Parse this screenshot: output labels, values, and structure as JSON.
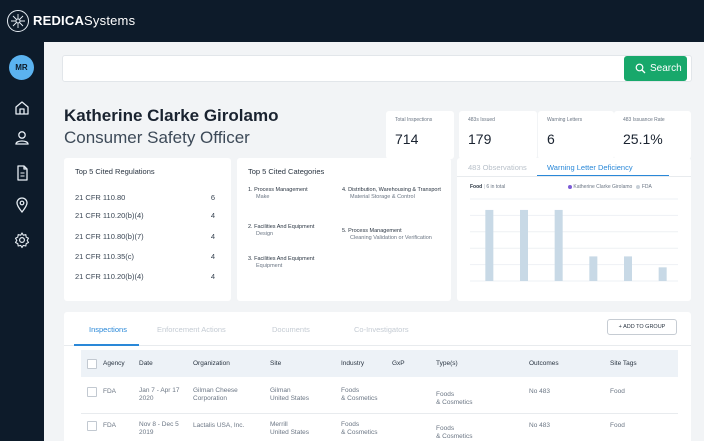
{
  "app": {
    "brand_bold": "REDICA",
    "brand_light": "Systems"
  },
  "user": {
    "initials": "MR"
  },
  "search": {
    "button_label": "Search",
    "placeholder": ""
  },
  "person": {
    "name": "Katherine Clarke Girolamo",
    "title": "Consumer Safety Officer"
  },
  "stats": [
    {
      "label": "Total Inspections",
      "value": "714"
    },
    {
      "label": "483s Issued",
      "value": "179"
    },
    {
      "label": "Warning Letters",
      "value": "6"
    },
    {
      "label": "483 Issuance Rate",
      "value": "25.1%"
    }
  ],
  "regulations": {
    "title": "Top 5 Cited Regulations",
    "items": [
      {
        "name": "21 CFR 110.80",
        "count": "6"
      },
      {
        "name": "21 CFR 110.20(b)(4)",
        "count": "4"
      },
      {
        "name": "21 CFR 110.80(b)(7)",
        "count": "4"
      },
      {
        "name": "21 CFR 110.35(c)",
        "count": "4"
      },
      {
        "name": "21 CFR 110.20(b)(4)",
        "count": "4"
      }
    ]
  },
  "categories": {
    "title": "Top 5 Cited Categories",
    "items": [
      {
        "main": "1. Process Management",
        "sub": "Make"
      },
      {
        "main": "2. Facilities And Equipment",
        "sub": "Design"
      },
      {
        "main": "3. Facilities And Equipment",
        "sub": "Equipment"
      },
      {
        "main": "4. Distribution, Warehousing & Transport",
        "sub": "Material Storage & Control"
      },
      {
        "main": "5. Process Management",
        "sub": "Cleaning Validation or Verification"
      }
    ]
  },
  "chart_panel": {
    "tabs": [
      "483 Observations",
      "Warning Letter Deficiency"
    ],
    "active_tab": 1,
    "filter_label": "Food",
    "filter_count": "6 in total",
    "legend": [
      {
        "name": "Katherine Clarke Girolamo",
        "color": "#7c5cd6"
      },
      {
        "name": "FDA",
        "color": "#c8d0d8"
      }
    ]
  },
  "chart_data": {
    "type": "bar",
    "categories": [
      "1",
      "2",
      "3",
      "4",
      "5",
      "6"
    ],
    "series": [
      {
        "name": "Katherine Clarke Girolamo",
        "color": "#7c5cd6",
        "values": [
          0,
          0,
          0,
          0,
          0,
          0
        ]
      },
      {
        "name": "FDA",
        "color": "#c8d9e6",
        "values": [
          5.2,
          5.2,
          5.2,
          1.8,
          1.8,
          1
        ]
      }
    ],
    "title": "",
    "xlabel": "",
    "ylabel": "",
    "ylim": [
      0,
      6
    ],
    "grid": true,
    "legend": "top-right"
  },
  "bottom": {
    "tabs": [
      "Inspections",
      "Enforcement Actions",
      "Documents",
      "Co-Investigators"
    ],
    "active_tab": 0,
    "add_group_label": "+ ADD TO GROUP",
    "columns": [
      "Agency",
      "Date",
      "Organization",
      "Site",
      "Industry",
      "GxP",
      "Type(s)",
      "Outcomes",
      "Site Tags"
    ],
    "rows": [
      {
        "agency": "FDA",
        "date1": "Jan 7 - Apr 17",
        "date2": "2020",
        "org1": "Gilman Cheese",
        "org2": "Corporation",
        "site1": "Gilman",
        "site2": "United States",
        "ind1": "Foods",
        "ind2": "& Cosmetics",
        "gxp": "",
        "type1": "Foods",
        "type2": "& Cosmetics",
        "outcome": "No 483",
        "tags": "Food"
      },
      {
        "agency": "FDA",
        "date1": "Nov 8 - Dec 5",
        "date2": "2019",
        "org1": "Lactalis USA, Inc.",
        "org2": "",
        "site1": "Merrill",
        "site2": "United States",
        "ind1": "Foods",
        "ind2": "& Cosmetics",
        "gxp": "",
        "type1": "Foods",
        "type2": "& Cosmetics",
        "outcome": "No 483",
        "tags": "Food"
      }
    ]
  }
}
